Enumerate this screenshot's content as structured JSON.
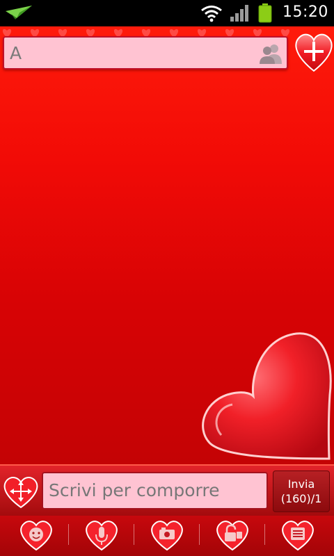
{
  "status_bar": {
    "time": "15:20"
  },
  "recipient": {
    "placeholder": "A"
  },
  "composer": {
    "placeholder": "Scrivi per comporre",
    "send_label": "Invia",
    "send_counter": "(160)/1"
  },
  "toolbar": {
    "tools": [
      "emoticon",
      "voice-record",
      "add-photo",
      "unlock-attachment",
      "templates"
    ]
  },
  "colors": {
    "background_top": "#ff1b0b",
    "background_bottom": "#c40305",
    "field_pink": "#ffc3d2",
    "heart_red": "#e8101d"
  }
}
